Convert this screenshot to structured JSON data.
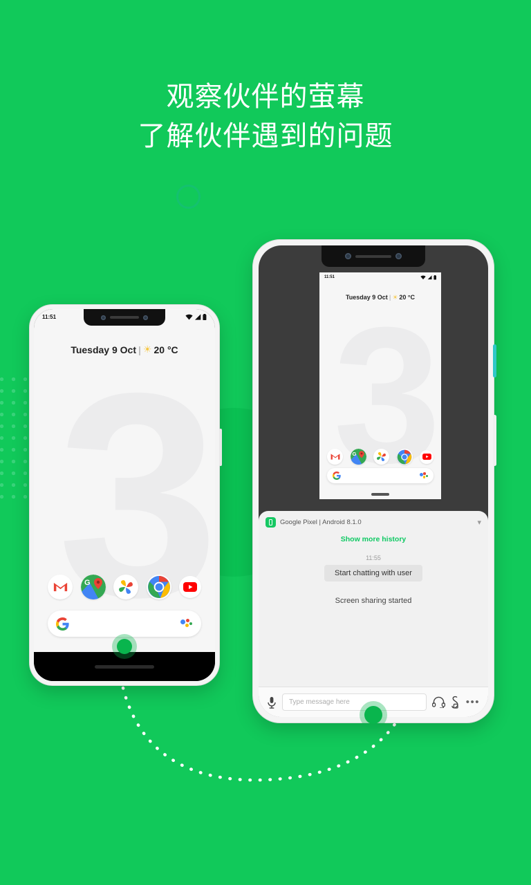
{
  "page": {
    "background_color": "#11c95a",
    "headline_lines": [
      "观察伙伴的萤幕",
      "了解伙伴遇到的问题"
    ]
  },
  "decor": {
    "ring_name": "teal-ring",
    "ring_color": "#14c170",
    "dot_grid_color": "#3bd47c",
    "connector_name": "dotted-connector-path",
    "connector_color": "#ffffff"
  },
  "phone_left": {
    "status": {
      "time": "11:51",
      "wifi": "wifi-icon",
      "signal": "signal-icon",
      "battery": "battery-icon"
    },
    "weather": {
      "date": "Tuesday 9 Oct",
      "separator": "|",
      "sun": "sun-icon",
      "temperature": "20 °C"
    },
    "wallpaper_glyph": "3",
    "dock": [
      {
        "name": "gmail",
        "label": "Gmail"
      },
      {
        "name": "maps",
        "label": "Maps"
      },
      {
        "name": "photos",
        "label": "Photos"
      },
      {
        "name": "chrome",
        "label": "Chrome"
      },
      {
        "name": "youtube",
        "label": "YouTube"
      }
    ],
    "search": {
      "logo": "google-g-icon",
      "assistant": "assistant-icon",
      "value": ""
    },
    "share_indicator": "screen-share-active-dot"
  },
  "phone_right": {
    "shared_screen": {
      "status": {
        "time": "11:51",
        "wifi": "wifi-icon",
        "signal": "signal-icon",
        "battery": "battery-icon"
      },
      "weather": {
        "date": "Tuesday 9 Oct",
        "separator": "|",
        "sun": "sun-icon",
        "temperature": "20 °C"
      },
      "wallpaper_glyph": "3",
      "dock": [
        {
          "name": "gmail",
          "label": "Gmail"
        },
        {
          "name": "maps",
          "label": "Maps"
        },
        {
          "name": "photos",
          "label": "Photos"
        },
        {
          "name": "chrome",
          "label": "Chrome"
        },
        {
          "name": "youtube",
          "label": "YouTube"
        }
      ],
      "search": {
        "logo": "google-g-icon",
        "assistant": "assistant-icon",
        "value": ""
      },
      "home_indicator": "home-pill"
    },
    "chat": {
      "header": {
        "device_icon": "device-phone-icon",
        "title": "Google Pixel | Android 8.1.0",
        "collapse": "chevron-down-icon"
      },
      "show_more": "Show more history",
      "timestamp": "11:55",
      "message": "Start chatting with user",
      "system_message": "Screen sharing started",
      "accent_color": "#0ec963"
    },
    "composer": {
      "mic": "microphone-icon",
      "input_placeholder": "Type message here",
      "input_value": "",
      "headset": "headset-icon",
      "pen": "pen-tool-icon",
      "more": "more-options-icon"
    },
    "share_indicator": "screen-share-active-dot"
  }
}
